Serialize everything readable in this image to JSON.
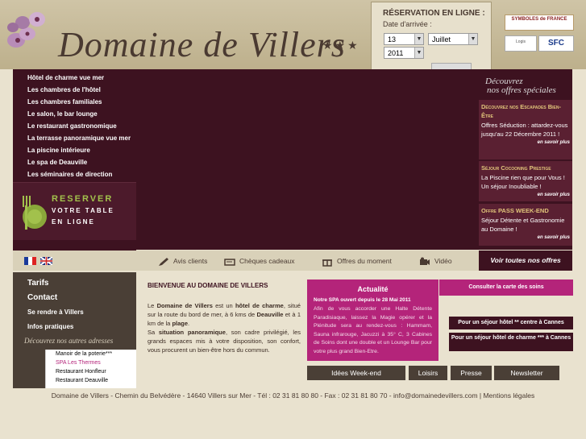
{
  "header": {
    "site_title": "Domaine de Villers",
    "stars": "★★★"
  },
  "booking": {
    "title": "RÉSERVATION EN LIGNE :",
    "arrival_label": "Date d'arrivée :",
    "day": "13",
    "month": "Juillet",
    "year": "2011"
  },
  "partners": {
    "p1": "SYMBOLES de FRANCE",
    "p2": "Logis",
    "p3": "SFC"
  },
  "nav": {
    "items": [
      "Hôtel de charme vue mer",
      "Les chambres de l'hôtel",
      "Les chambres familiales",
      "Le salon, le bar lounge",
      "Le restaurant gastronomique",
      "La terrasse panoramique vue mer",
      "La piscine intérieure",
      "Le spa de Deauville",
      "Les séminaires de direction"
    ]
  },
  "reserve": {
    "line1": "RESERVER",
    "line2": "VOTRE TABLE",
    "line3": "EN LIGNE"
  },
  "offers": {
    "heading_l1": "Découvrez",
    "heading_l2": "nos offres spéciales",
    "items": [
      {
        "title": "Découvrez nos Escapades Bien-Être",
        "text": "Offres Séduction : attardez-vous jusqu'au 22 Décembre 2011 !",
        "more": "en savoir plus"
      },
      {
        "title": "Séjour Cocooning Prestige",
        "text": "La Piscine rien que pour Vous ! Un séjour Inoubliable !",
        "more": "en savoir plus"
      },
      {
        "title": "Offre PASS WEEK-END",
        "text": "Séjour Détente et Gastronomie au Domaine !",
        "more": "en savoir plus"
      }
    ]
  },
  "bar": {
    "avis": "Avis clients",
    "cheques": "Chèques cadeaux",
    "moment": "Offres du moment",
    "video": "Vidéo",
    "all_offers": "Voir toutes nos offres"
  },
  "side": {
    "tarifs": "Tarifs",
    "contact": "Contact",
    "rendre": "Se rendre à Villers",
    "infos": "Infos pratiques",
    "heading": "Découvrez nos autres adresses",
    "addresses": [
      "Manoir de la poterie***",
      "SPA Les Thermes",
      "Restaurant Honfleur",
      "Restaurant Deauville"
    ]
  },
  "welcome": {
    "title": "BIENVENUE AU DOMAINE DE VILLERS",
    "p1_a": "Le ",
    "p1_b": "Domaine de Villers",
    "p1_c": " est un ",
    "p1_d": "hôtel de charme",
    "p1_e": ", situé sur la route du bord de mer, à 6 kms de ",
    "p1_f": "Deauville",
    "p1_g": " et à 1 km de la ",
    "p1_h": "plage",
    "p1_i": ".",
    "p2_a": "Sa ",
    "p2_b": "situation panoramique",
    "p2_c": ", son cadre privilégié, les grands espaces mis à votre disposition, son confort, vous procurent un bien-être hors du commun."
  },
  "news": {
    "title": "Actualité",
    "head": "Notre SPA ouvert depuis le 28 Mai 2011",
    "text": "Afin de vous accorder une Halte Détente Paradisiaque, laissez la Magie opérer et la Plénitude sera au rendez-vous : Hammam, Sauna infrarouge, Jacuzzi à 35° C, 3 Cabines de Soins dont une double et un Lounge Bar pour votre plus grand Bien-Etre."
  },
  "buttons": {
    "soins": "Consulter la carte des soins",
    "cannes1": "Pour un séjour hôtel ** centre à Cannes",
    "cannes2": "Pour un séjour hôtel de charme *** à Cannes",
    "weekend": "Idées Week-end",
    "loisirs": "Loisirs",
    "presse": "Presse",
    "newsletter": "Newsletter"
  },
  "footer": {
    "text": "Domaine de Villers - Chemin du Belvédère - 14640 Villers sur Mer - Tél : 02 31 81 80 80 - Fax : 02 31 81 80 70 - info@domainedevillers.com | Mentions légales"
  }
}
